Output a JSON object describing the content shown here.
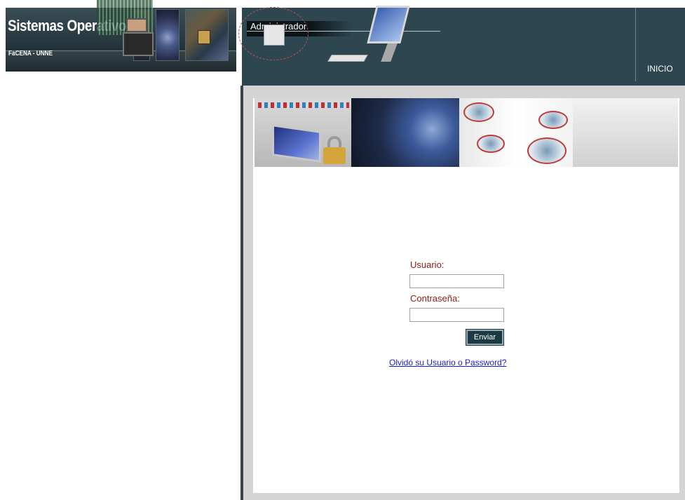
{
  "site": {
    "title": "Sistemas Operativos",
    "subtitle": "FaCENA - UNNE"
  },
  "header": {
    "section_label": "Administrador",
    "nav": [
      {
        "label": "INICIO"
      }
    ]
  },
  "login": {
    "username_label": "Usuario:",
    "username_value": "",
    "password_label": "Contraseña:",
    "password_value": "",
    "submit_label": "Enviar",
    "forgot_link": "Olvidó su Usuario o Password?"
  },
  "colors": {
    "header_bg": "#2d4650",
    "label_text": "#8b1a1a",
    "link": "#1a1ad0",
    "button_bg": "#1c3a44",
    "frame_gray": "#d4d4d4"
  },
  "icons": [
    "logo-image",
    "banner-image"
  ]
}
